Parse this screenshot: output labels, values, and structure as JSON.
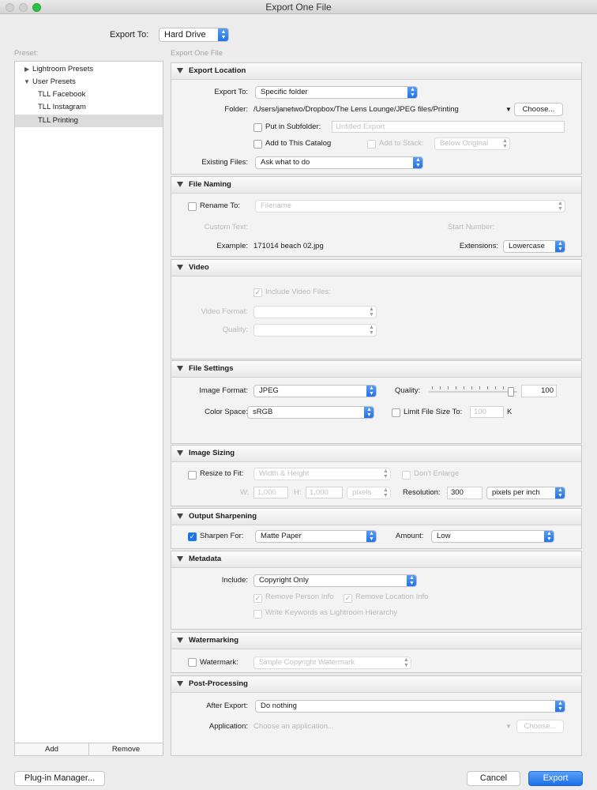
{
  "window": {
    "title": "Export One File"
  },
  "top": {
    "export_to_label": "Export To:",
    "export_to_value": "Hard Drive"
  },
  "sidebar": {
    "preset_label": "Preset:",
    "items": [
      {
        "label": "Lightroom Presets"
      },
      {
        "label": "User Presets"
      },
      {
        "label": "TLL Facebook"
      },
      {
        "label": "TLL Instagram"
      },
      {
        "label": "TLL Printing"
      }
    ],
    "add_label": "Add",
    "remove_label": "Remove"
  },
  "main": {
    "heading": "Export One File"
  },
  "export_location": {
    "title": "Export Location",
    "export_to_label": "Export To:",
    "export_to_value": "Specific folder",
    "folder_label": "Folder:",
    "folder_path": "/Users/janetwo/Dropbox/The Lens Lounge/JPEG files/Printing",
    "choose_label": "Choose...",
    "subfolder_label": "Put in Subfolder:",
    "subfolder_placeholder": "Untitled Export",
    "add_catalog_label": "Add to This Catalog",
    "add_stack_label": "Add to Stack:",
    "stack_value": "Below Original",
    "existing_label": "Existing Files:",
    "existing_value": "Ask what to do"
  },
  "file_naming": {
    "title": "File Naming",
    "rename_label": "Rename To:",
    "rename_value": "Filename",
    "custom_text_label": "Custom Text:",
    "start_number_label": "Start Number:",
    "example_label": "Example:",
    "example_value": "171014 beach 02.jpg",
    "extensions_label": "Extensions:",
    "extensions_value": "Lowercase"
  },
  "video": {
    "title": "Video",
    "include_label": "Include Video Files:",
    "format_label": "Video Format:",
    "quality_label": "Quality:"
  },
  "file_settings": {
    "title": "File Settings",
    "format_label": "Image Format:",
    "format_value": "JPEG",
    "quality_label": "Quality:",
    "quality_value": "100",
    "color_space_label": "Color Space:",
    "color_space_value": "sRGB",
    "limit_label": "Limit File Size To:",
    "limit_value": "100",
    "limit_unit": "K"
  },
  "image_sizing": {
    "title": "Image Sizing",
    "resize_label": "Resize to Fit:",
    "resize_value": "Width & Height",
    "dont_enlarge_label": "Don't Enlarge",
    "w_label": "W:",
    "w_value": "1,000",
    "h_label": "H:",
    "h_value": "1,000",
    "units_value": "pixels",
    "resolution_label": "Resolution:",
    "resolution_value": "300",
    "resolution_unit": "pixels per inch"
  },
  "output_sharpening": {
    "title": "Output Sharpening",
    "sharpen_label": "Sharpen For:",
    "sharpen_value": "Matte Paper",
    "amount_label": "Amount:",
    "amount_value": "Low"
  },
  "metadata": {
    "title": "Metadata",
    "include_label": "Include:",
    "include_value": "Copyright Only",
    "remove_person_label": "Remove Person Info",
    "remove_location_label": "Remove Location Info",
    "keywords_label": "Write Keywords as Lightroom Hierarchy"
  },
  "watermarking": {
    "title": "Watermarking",
    "watermark_label": "Watermark:",
    "watermark_value": "Simple Copyright Watermark"
  },
  "post_processing": {
    "title": "Post-Processing",
    "after_export_label": "After Export:",
    "after_export_value": "Do nothing",
    "application_label": "Application:",
    "application_placeholder": "Choose an application...",
    "choose_label": "Choose..."
  },
  "footer": {
    "plugin_label": "Plug-in Manager...",
    "cancel_label": "Cancel",
    "export_label": "Export"
  },
  "colors": {
    "accent": "#1f74ea",
    "selection": "#dcdcdc",
    "window_bg": "#ececec"
  }
}
